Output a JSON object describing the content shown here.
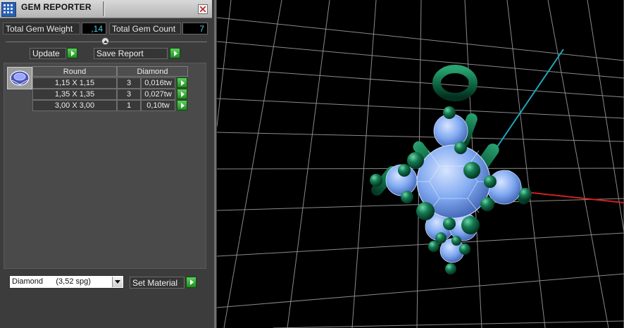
{
  "window": {
    "title": "GEM REPORTER"
  },
  "summary": {
    "weight_label": "Total Gem Weight",
    "weight_value": ",14",
    "count_label": "Total Gem Count",
    "count_value": "7"
  },
  "actions": {
    "update_label": "Update",
    "save_label": "Save Report"
  },
  "table": {
    "headers": [
      "Round",
      "Diamond"
    ],
    "rows": [
      {
        "size": "1,15 X 1,15",
        "qty": "3",
        "weight": "0,016tw"
      },
      {
        "size": "1,35 X 1,35",
        "qty": "3",
        "weight": "0,027tw"
      },
      {
        "size": "3,00 X 3,00",
        "qty": "1",
        "weight": "0,10tw"
      }
    ]
  },
  "material": {
    "selected": "Diamond      (3,52 spg)",
    "set_label": "Set Material"
  },
  "colors": {
    "value_text": "#4fd1e8",
    "action_arrow": "#2fb02f",
    "gem_blue": "#7fa8f0",
    "prong_green": "#0f5c3e",
    "axis_x": "#d02020",
    "axis_y": "#1ea8b8"
  },
  "icons": [
    "app-grid-icon",
    "close-icon",
    "divider-collapse-icon",
    "play-arrow-icon",
    "gem-thumbnail-icon",
    "chevron-down-icon"
  ]
}
